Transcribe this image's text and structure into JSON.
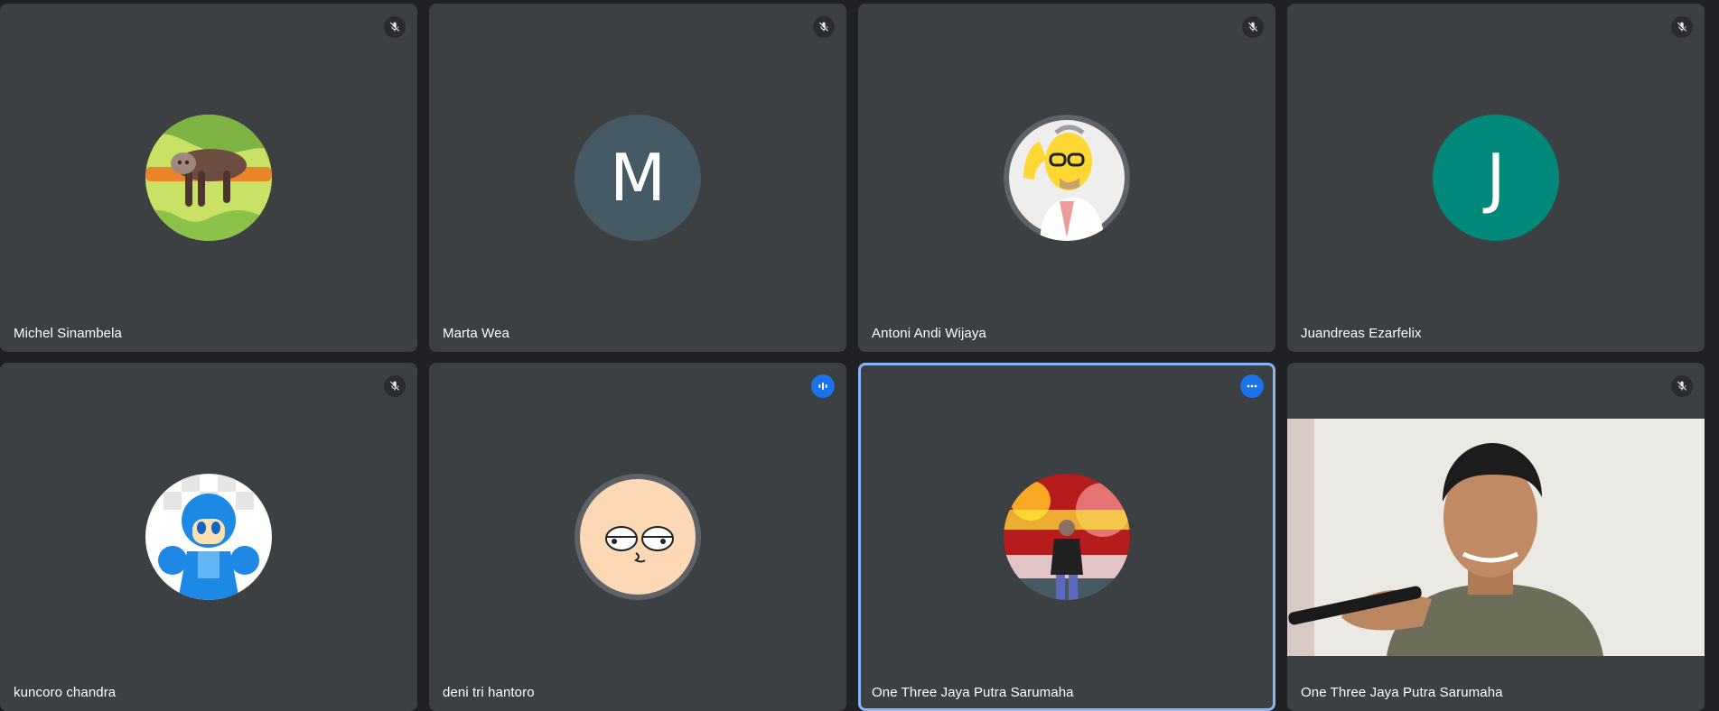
{
  "participants": [
    {
      "name": "Michel Sinambela",
      "avatar": "sloth-avatar",
      "status": "mic-off-icon"
    },
    {
      "name": "Marta Wea",
      "avatar_letter": "M",
      "avatar_color": "#455a64",
      "status": "mic-off-icon"
    },
    {
      "name": "Antoni Andi Wijaya",
      "avatar": "cartoon-man-avatar",
      "status": "mic-off-icon"
    },
    {
      "name": "Juandreas Ezarfelix",
      "avatar_letter": "J",
      "avatar_color": "#00897b",
      "status": "mic-off-icon"
    },
    {
      "name": "kuncoro chandra",
      "avatar": "robot-hero-avatar",
      "status": "mic-off-icon"
    },
    {
      "name": "deni tri hantoro",
      "avatar": "cartoon-face-avatar",
      "status": "speaking-icon"
    },
    {
      "name": "One Three Jaya Putra Sarumaha",
      "avatar": "photo-avatar",
      "status": "more-options-icon",
      "active": true
    },
    {
      "name": "One Three Jaya Putra Sarumaha",
      "video": "camera-feed",
      "status": "mic-off-icon"
    }
  ],
  "colors": {
    "background": "#202124",
    "tile": "#3c4043",
    "active_border": "#8ab4f8",
    "accent": "#1a73e8"
  }
}
